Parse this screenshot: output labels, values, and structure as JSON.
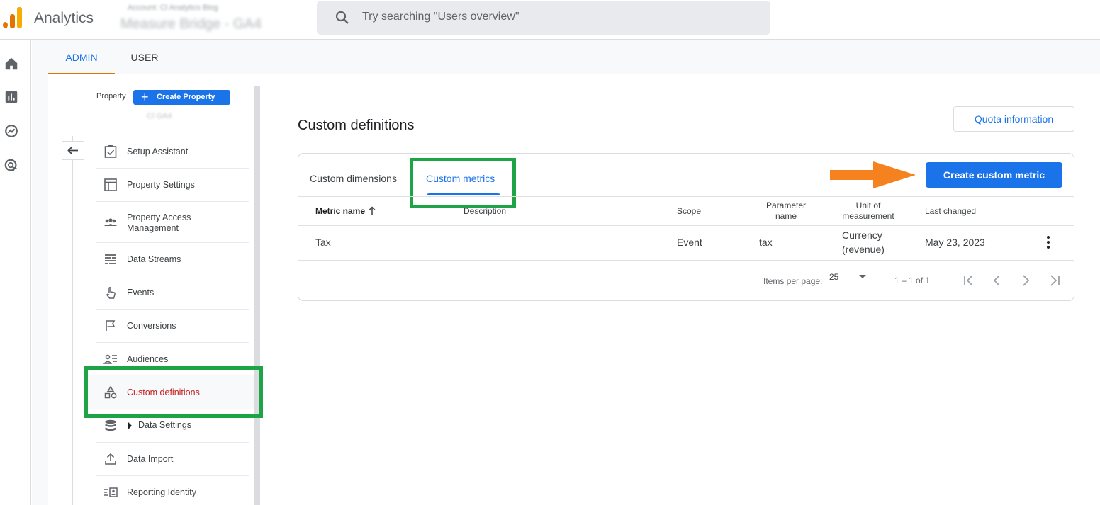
{
  "header": {
    "app_name": "Analytics",
    "account_small": "Account: Cl Analytics Blog",
    "account_big": "Measure Bridge - GA4",
    "search_placeholder": "Try searching \"Users overview\""
  },
  "admin_tabs": {
    "admin": "ADMIN",
    "user": "USER"
  },
  "nav": {
    "property_label": "Property",
    "create_property": "Create Property",
    "property_name": "Cl GA4",
    "items": [
      {
        "label": "Setup Assistant",
        "icon": "checklist-icon"
      },
      {
        "label": "Property Settings",
        "icon": "layout-icon"
      },
      {
        "label": "Property Access Management",
        "icon": "people-icon"
      },
      {
        "label": "Data Streams",
        "icon": "streams-icon"
      },
      {
        "label": "Events",
        "icon": "touch-icon"
      },
      {
        "label": "Conversions",
        "icon": "flag-icon"
      },
      {
        "label": "Audiences",
        "icon": "audience-icon"
      },
      {
        "label": "Custom definitions",
        "icon": "shapes-icon"
      },
      {
        "label": "Data Settings",
        "icon": "database-icon"
      },
      {
        "label": "Data Import",
        "icon": "upload-icon"
      },
      {
        "label": "Reporting Identity",
        "icon": "identity-icon"
      }
    ]
  },
  "main": {
    "title": "Custom definitions",
    "quota_button": "Quota information",
    "tabs": {
      "dimensions": "Custom dimensions",
      "metrics": "Custom metrics"
    },
    "create_button": "Create custom metric",
    "columns": {
      "metric_name": "Metric name",
      "description": "Description",
      "scope": "Scope",
      "parameter_name": "Parameter name",
      "unit": "Unit of measurement",
      "last_changed": "Last changed"
    },
    "rows": [
      {
        "metric_name": "Tax",
        "description": "",
        "scope": "Event",
        "parameter_name": "tax",
        "unit": "Currency (revenue)",
        "last_changed": "May 23, 2023"
      }
    ],
    "pagination": {
      "items_per_page_label": "Items per page:",
      "items_per_page": "25",
      "range": "1 – 1 of 1"
    }
  },
  "colors": {
    "accent_blue": "#1a73e8",
    "highlight_green": "#1ea446",
    "arrow_orange": "#f5821f",
    "active_red": "#c5221f",
    "logo_orange": "#f9ab00",
    "logo_dark_orange": "#e37400"
  }
}
